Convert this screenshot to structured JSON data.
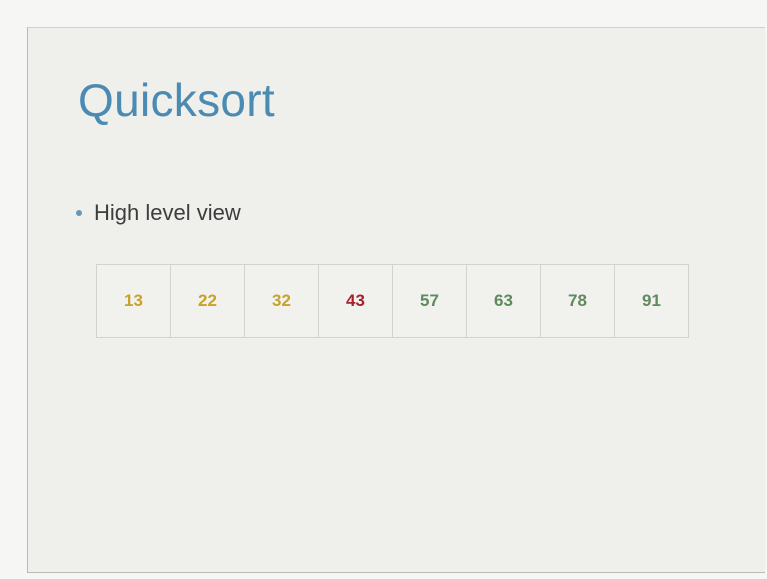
{
  "slide": {
    "title": "Quicksort",
    "bullet": "High level view",
    "array": [
      {
        "value": "13",
        "color": "#c9a227"
      },
      {
        "value": "22",
        "color": "#c9a227"
      },
      {
        "value": "32",
        "color": "#c9a227"
      },
      {
        "value": "43",
        "color": "#a3232f"
      },
      {
        "value": "57",
        "color": "#5f8a5e"
      },
      {
        "value": "63",
        "color": "#5f8a5e"
      },
      {
        "value": "78",
        "color": "#5f8a5e"
      },
      {
        "value": "91",
        "color": "#5f8a5e"
      }
    ]
  },
  "colors": {
    "title": "#4b8bb3",
    "bullet_dot": "#6a96b5",
    "text": "#3d3d3d"
  },
  "icons": {
    "bullet": "bullet-dot-icon"
  }
}
